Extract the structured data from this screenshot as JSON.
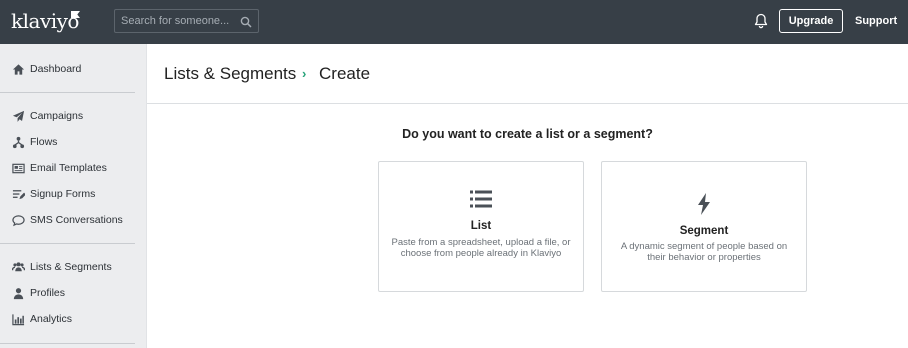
{
  "app": {
    "logo_text": "klaviyo"
  },
  "topbar": {
    "search_placeholder": "Search for someone...",
    "upgrade_label": "Upgrade",
    "support_label": "Support"
  },
  "sidebar": {
    "groups": [
      {
        "items": [
          {
            "label": "Dashboard",
            "icon": "home-icon"
          }
        ]
      },
      {
        "items": [
          {
            "label": "Campaigns",
            "icon": "paper-plane-icon"
          },
          {
            "label": "Flows",
            "icon": "flows-icon"
          },
          {
            "label": "Email Templates",
            "icon": "newspaper-icon"
          },
          {
            "label": "Signup Forms",
            "icon": "form-list-icon"
          },
          {
            "label": "SMS Conversations",
            "icon": "chat-icon"
          }
        ]
      },
      {
        "items": [
          {
            "label": "Lists & Segments",
            "icon": "users-icon"
          },
          {
            "label": "Profiles",
            "icon": "user-icon"
          },
          {
            "label": "Analytics",
            "icon": "bar-chart-icon"
          }
        ]
      }
    ]
  },
  "header": {
    "breadcrumb_root": "Lists & Segments",
    "breadcrumb_separator": "›",
    "breadcrumb_current": "Create"
  },
  "main": {
    "question": "Do you want to create a list or a segment?",
    "options": [
      {
        "title": "List",
        "description": "Paste from a spreadsheet, upload a file, or choose from people already in Klaviyo",
        "icon": "list-icon"
      },
      {
        "title": "Segment",
        "description": "A dynamic segment of people based on their behavior or properties",
        "icon": "lightning-icon"
      }
    ]
  },
  "colors": {
    "topbar": "#373f47",
    "sidebar": "#ecedef",
    "accent": "#27a37a"
  }
}
